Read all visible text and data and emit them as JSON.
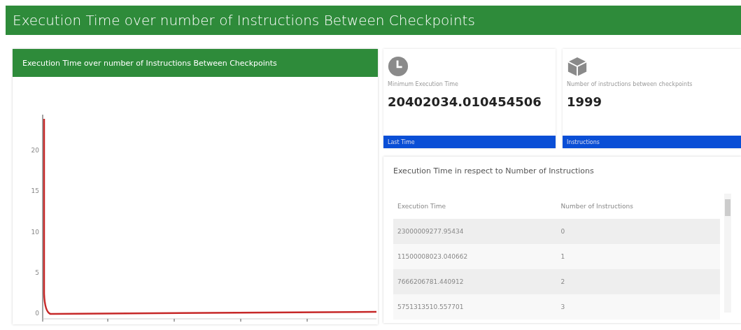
{
  "header": {
    "title": "Execution Time over number of Instructions Between Checkpoints"
  },
  "chart_panel": {
    "title": "Execution Time over number of Instructions Between Checkpoints",
    "y_tick_labels": [
      "20",
      "15",
      "10",
      "5",
      "0"
    ]
  },
  "stats": [
    {
      "kind": "clock",
      "label": "Minimum Execution Time",
      "value": "20402034.010454506",
      "footer": "Last Time"
    },
    {
      "kind": "cube",
      "label": "Number of instructions between checkpoints",
      "value": "1999",
      "footer": "Instructions"
    }
  ],
  "table": {
    "title": "Execution Time in respect to Number of Instructions",
    "columns": [
      "Execution Time",
      "Number of Instructions"
    ],
    "rows": [
      [
        "23000009277.95434",
        "0"
      ],
      [
        "11500008023.040662",
        "1"
      ],
      [
        "7666206781.440912",
        "2"
      ],
      [
        "5751313510.557701",
        "3"
      ]
    ]
  }
}
